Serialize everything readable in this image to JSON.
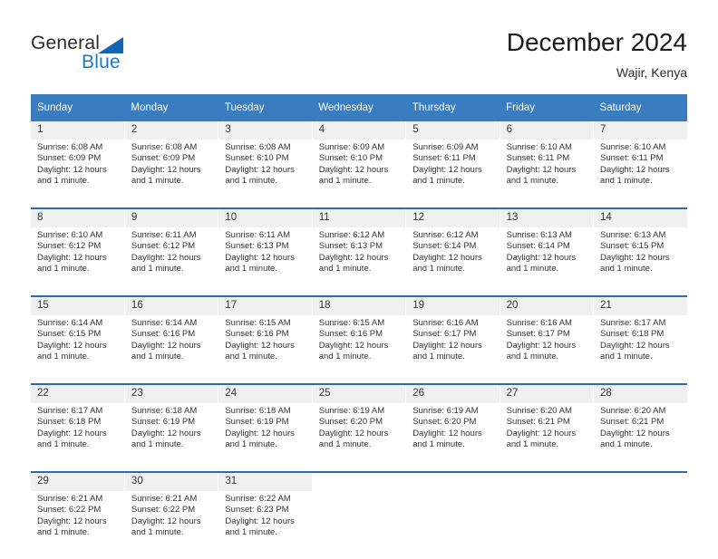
{
  "brand": {
    "name_part1": "General",
    "name_part2": "Blue",
    "accent_color": "#1f7ac4",
    "triangle_color": "#1565b4"
  },
  "header": {
    "title": "December 2024",
    "location": "Wajir, Kenya"
  },
  "theme": {
    "header_bg": "#3a7cc0",
    "daynum_bg": "#f0f0f0",
    "week_separator": "#2b6cb0",
    "text": "#333333"
  },
  "weekday_headers": [
    "Sunday",
    "Monday",
    "Tuesday",
    "Wednesday",
    "Thursday",
    "Friday",
    "Saturday"
  ],
  "weeks": [
    {
      "days": [
        {
          "date": "1",
          "sunrise": "Sunrise: 6:08 AM",
          "sunset": "Sunset: 6:09 PM",
          "daylight_line1": "Daylight: 12 hours",
          "daylight_line2": "and 1 minute."
        },
        {
          "date": "2",
          "sunrise": "Sunrise: 6:08 AM",
          "sunset": "Sunset: 6:09 PM",
          "daylight_line1": "Daylight: 12 hours",
          "daylight_line2": "and 1 minute."
        },
        {
          "date": "3",
          "sunrise": "Sunrise: 6:08 AM",
          "sunset": "Sunset: 6:10 PM",
          "daylight_line1": "Daylight: 12 hours",
          "daylight_line2": "and 1 minute."
        },
        {
          "date": "4",
          "sunrise": "Sunrise: 6:09 AM",
          "sunset": "Sunset: 6:10 PM",
          "daylight_line1": "Daylight: 12 hours",
          "daylight_line2": "and 1 minute."
        },
        {
          "date": "5",
          "sunrise": "Sunrise: 6:09 AM",
          "sunset": "Sunset: 6:11 PM",
          "daylight_line1": "Daylight: 12 hours",
          "daylight_line2": "and 1 minute."
        },
        {
          "date": "6",
          "sunrise": "Sunrise: 6:10 AM",
          "sunset": "Sunset: 6:11 PM",
          "daylight_line1": "Daylight: 12 hours",
          "daylight_line2": "and 1 minute."
        },
        {
          "date": "7",
          "sunrise": "Sunrise: 6:10 AM",
          "sunset": "Sunset: 6:11 PM",
          "daylight_line1": "Daylight: 12 hours",
          "daylight_line2": "and 1 minute."
        }
      ]
    },
    {
      "days": [
        {
          "date": "8",
          "sunrise": "Sunrise: 6:10 AM",
          "sunset": "Sunset: 6:12 PM",
          "daylight_line1": "Daylight: 12 hours",
          "daylight_line2": "and 1 minute."
        },
        {
          "date": "9",
          "sunrise": "Sunrise: 6:11 AM",
          "sunset": "Sunset: 6:12 PM",
          "daylight_line1": "Daylight: 12 hours",
          "daylight_line2": "and 1 minute."
        },
        {
          "date": "10",
          "sunrise": "Sunrise: 6:11 AM",
          "sunset": "Sunset: 6:13 PM",
          "daylight_line1": "Daylight: 12 hours",
          "daylight_line2": "and 1 minute."
        },
        {
          "date": "11",
          "sunrise": "Sunrise: 6:12 AM",
          "sunset": "Sunset: 6:13 PM",
          "daylight_line1": "Daylight: 12 hours",
          "daylight_line2": "and 1 minute."
        },
        {
          "date": "12",
          "sunrise": "Sunrise: 6:12 AM",
          "sunset": "Sunset: 6:14 PM",
          "daylight_line1": "Daylight: 12 hours",
          "daylight_line2": "and 1 minute."
        },
        {
          "date": "13",
          "sunrise": "Sunrise: 6:13 AM",
          "sunset": "Sunset: 6:14 PM",
          "daylight_line1": "Daylight: 12 hours",
          "daylight_line2": "and 1 minute."
        },
        {
          "date": "14",
          "sunrise": "Sunrise: 6:13 AM",
          "sunset": "Sunset: 6:15 PM",
          "daylight_line1": "Daylight: 12 hours",
          "daylight_line2": "and 1 minute."
        }
      ]
    },
    {
      "days": [
        {
          "date": "15",
          "sunrise": "Sunrise: 6:14 AM",
          "sunset": "Sunset: 6:15 PM",
          "daylight_line1": "Daylight: 12 hours",
          "daylight_line2": "and 1 minute."
        },
        {
          "date": "16",
          "sunrise": "Sunrise: 6:14 AM",
          "sunset": "Sunset: 6:16 PM",
          "daylight_line1": "Daylight: 12 hours",
          "daylight_line2": "and 1 minute."
        },
        {
          "date": "17",
          "sunrise": "Sunrise: 6:15 AM",
          "sunset": "Sunset: 6:16 PM",
          "daylight_line1": "Daylight: 12 hours",
          "daylight_line2": "and 1 minute."
        },
        {
          "date": "18",
          "sunrise": "Sunrise: 6:15 AM",
          "sunset": "Sunset: 6:16 PM",
          "daylight_line1": "Daylight: 12 hours",
          "daylight_line2": "and 1 minute."
        },
        {
          "date": "19",
          "sunrise": "Sunrise: 6:16 AM",
          "sunset": "Sunset: 6:17 PM",
          "daylight_line1": "Daylight: 12 hours",
          "daylight_line2": "and 1 minute."
        },
        {
          "date": "20",
          "sunrise": "Sunrise: 6:16 AM",
          "sunset": "Sunset: 6:17 PM",
          "daylight_line1": "Daylight: 12 hours",
          "daylight_line2": "and 1 minute."
        },
        {
          "date": "21",
          "sunrise": "Sunrise: 6:17 AM",
          "sunset": "Sunset: 6:18 PM",
          "daylight_line1": "Daylight: 12 hours",
          "daylight_line2": "and 1 minute."
        }
      ]
    },
    {
      "days": [
        {
          "date": "22",
          "sunrise": "Sunrise: 6:17 AM",
          "sunset": "Sunset: 6:18 PM",
          "daylight_line1": "Daylight: 12 hours",
          "daylight_line2": "and 1 minute."
        },
        {
          "date": "23",
          "sunrise": "Sunrise: 6:18 AM",
          "sunset": "Sunset: 6:19 PM",
          "daylight_line1": "Daylight: 12 hours",
          "daylight_line2": "and 1 minute."
        },
        {
          "date": "24",
          "sunrise": "Sunrise: 6:18 AM",
          "sunset": "Sunset: 6:19 PM",
          "daylight_line1": "Daylight: 12 hours",
          "daylight_line2": "and 1 minute."
        },
        {
          "date": "25",
          "sunrise": "Sunrise: 6:19 AM",
          "sunset": "Sunset: 6:20 PM",
          "daylight_line1": "Daylight: 12 hours",
          "daylight_line2": "and 1 minute."
        },
        {
          "date": "26",
          "sunrise": "Sunrise: 6:19 AM",
          "sunset": "Sunset: 6:20 PM",
          "daylight_line1": "Daylight: 12 hours",
          "daylight_line2": "and 1 minute."
        },
        {
          "date": "27",
          "sunrise": "Sunrise: 6:20 AM",
          "sunset": "Sunset: 6:21 PM",
          "daylight_line1": "Daylight: 12 hours",
          "daylight_line2": "and 1 minute."
        },
        {
          "date": "28",
          "sunrise": "Sunrise: 6:20 AM",
          "sunset": "Sunset: 6:21 PM",
          "daylight_line1": "Daylight: 12 hours",
          "daylight_line2": "and 1 minute."
        }
      ]
    },
    {
      "days": [
        {
          "date": "29",
          "sunrise": "Sunrise: 6:21 AM",
          "sunset": "Sunset: 6:22 PM",
          "daylight_line1": "Daylight: 12 hours",
          "daylight_line2": "and 1 minute."
        },
        {
          "date": "30",
          "sunrise": "Sunrise: 6:21 AM",
          "sunset": "Sunset: 6:22 PM",
          "daylight_line1": "Daylight: 12 hours",
          "daylight_line2": "and 1 minute."
        },
        {
          "date": "31",
          "sunrise": "Sunrise: 6:22 AM",
          "sunset": "Sunset: 6:23 PM",
          "daylight_line1": "Daylight: 12 hours",
          "daylight_line2": "and 1 minute."
        },
        {
          "date": "",
          "sunrise": "",
          "sunset": "",
          "daylight_line1": "",
          "daylight_line2": ""
        },
        {
          "date": "",
          "sunrise": "",
          "sunset": "",
          "daylight_line1": "",
          "daylight_line2": ""
        },
        {
          "date": "",
          "sunrise": "",
          "sunset": "",
          "daylight_line1": "",
          "daylight_line2": ""
        },
        {
          "date": "",
          "sunrise": "",
          "sunset": "",
          "daylight_line1": "",
          "daylight_line2": ""
        }
      ]
    }
  ]
}
